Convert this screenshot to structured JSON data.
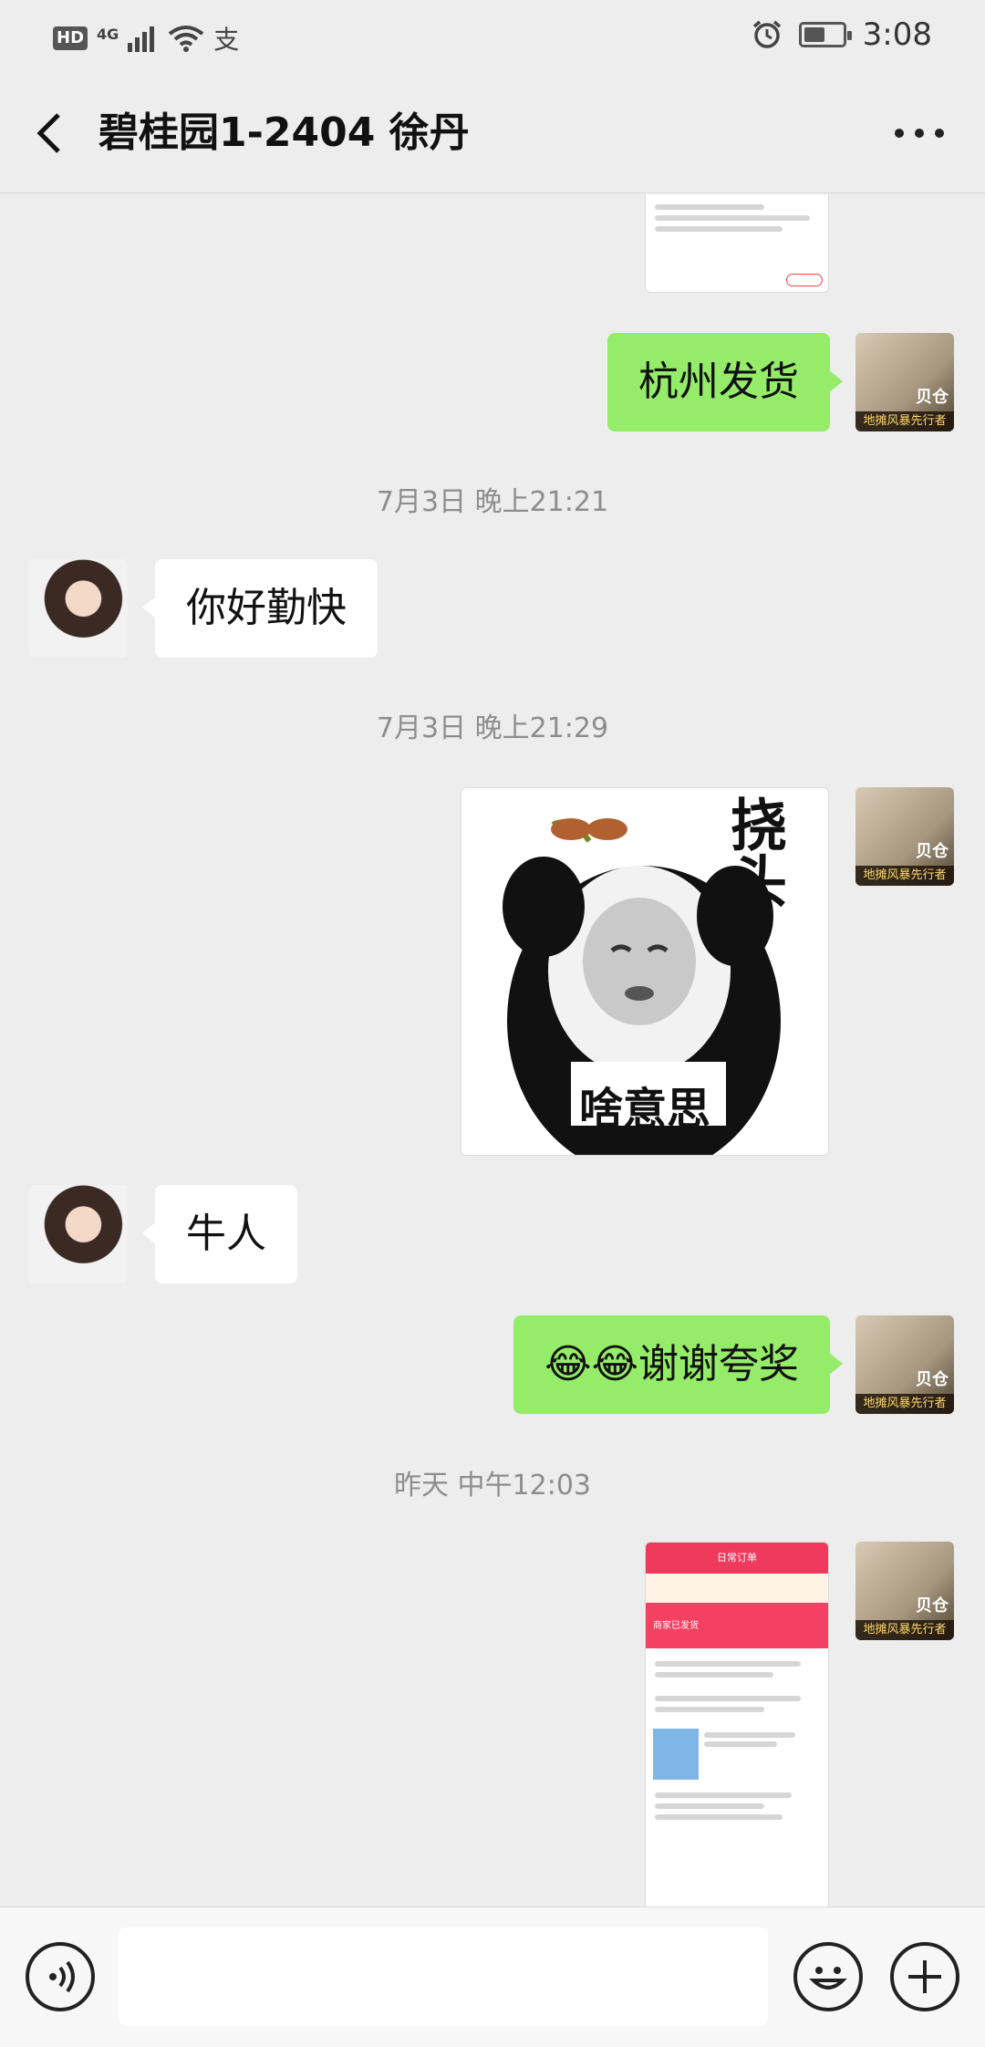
{
  "status": {
    "hd": "HD",
    "network": "4G",
    "time": "3:08",
    "alipay": "支"
  },
  "header": {
    "title": "碧桂园1-2404 徐丹"
  },
  "messages": {
    "m1": "杭州发货",
    "t1": "7月3日 晚上21:21",
    "m2": "你好勤快",
    "t2": "7月3日 晚上21:29",
    "sticker_top": "挠头",
    "sticker_bottom": "啥意思",
    "m3": "牛人",
    "m4_emoji": "😂😂",
    "m4_text": "谢谢夸奖",
    "t3": "昨天 中午12:03"
  },
  "avatar_self": {
    "tag": "地摊风暴先行者",
    "name": "贝仓"
  },
  "screenshot_top": {
    "name": "日常订单",
    "status": "商家已发货"
  }
}
